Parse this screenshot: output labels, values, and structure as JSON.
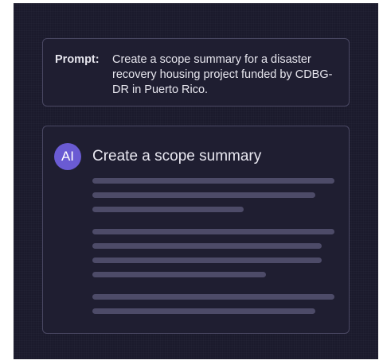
{
  "prompt": {
    "label": "Prompt:",
    "text": "Create a scope summary for a disaster recovery housing project funded by CDBG-DR in Puerto Rico."
  },
  "response": {
    "avatar_text": "AI",
    "title": "Create a scope summary",
    "placeholder_paragraphs": [
      3,
      4,
      2
    ]
  },
  "colors": {
    "background": "#1b1a2c",
    "card": "#1f1e31",
    "border": "#4a4863",
    "avatar": "#6a5bd3",
    "placeholder": "#4d4b68"
  }
}
